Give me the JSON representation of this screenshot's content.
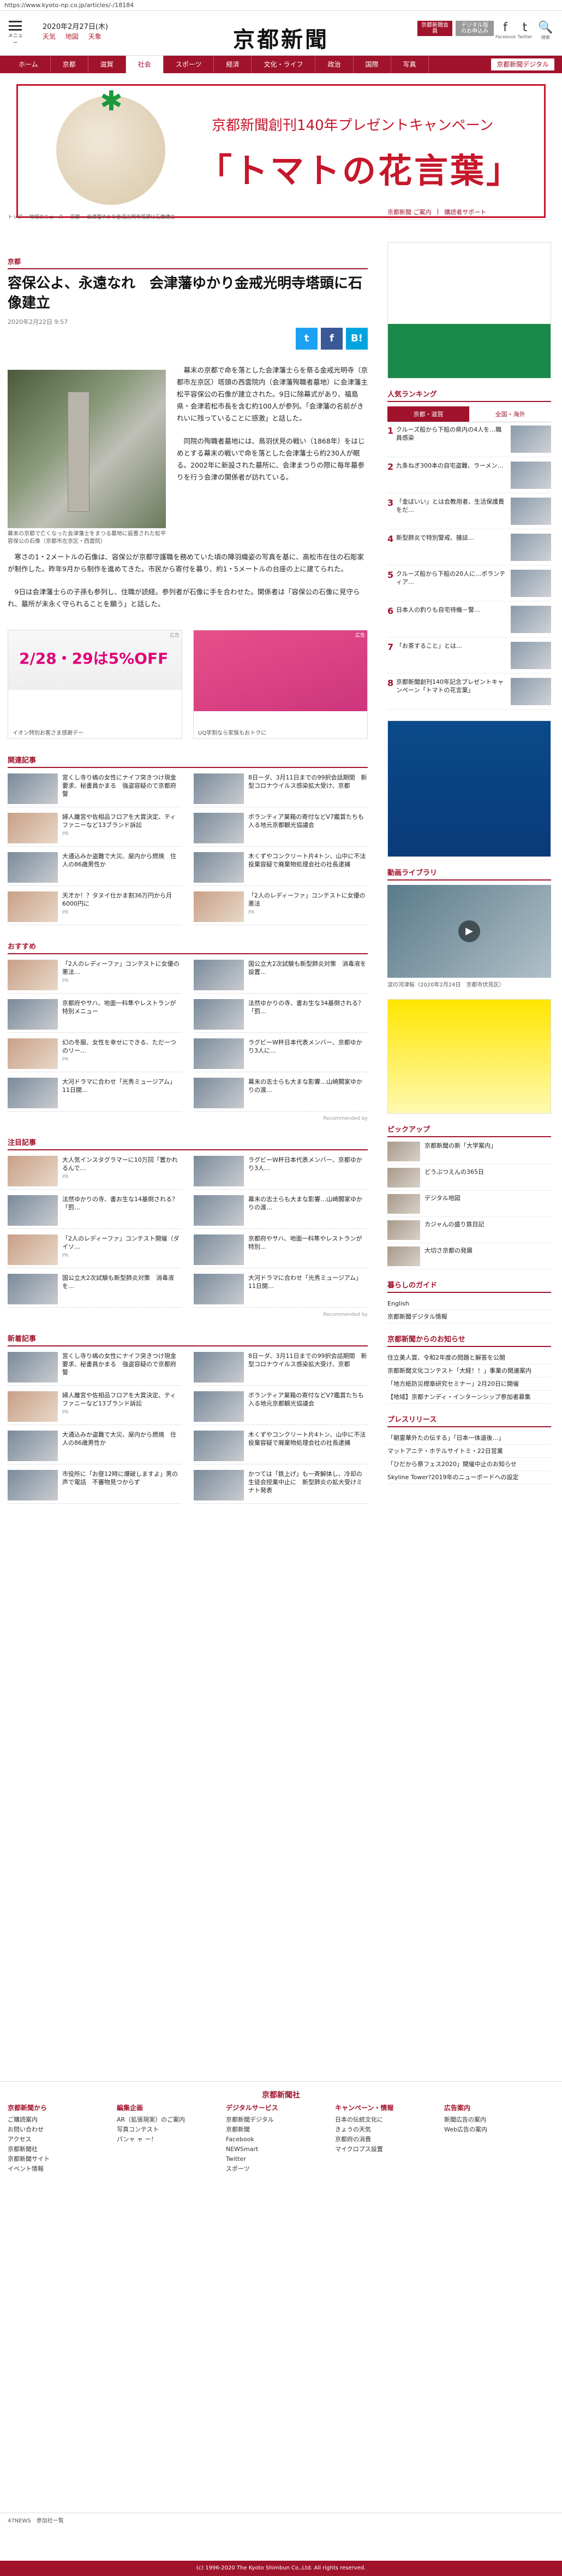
{
  "browser": {
    "url": "https://www.kyoto-np.co.jp/articles/-/18184"
  },
  "header": {
    "menu_label": "メニュー",
    "date": "2020年2月27日(木)",
    "weather": [
      "天気",
      "地図",
      "天象"
    ],
    "logo": "京都新聞",
    "btn_member": "京都新聞会員",
    "btn_subscribe": "デジタル版のお申込み",
    "social": [
      {
        "icon": "f",
        "label": "Facebook"
      },
      {
        "icon": "t",
        "label": "Twitter"
      },
      {
        "icon": "🔍",
        "label": "検索"
      }
    ]
  },
  "nav": {
    "items": [
      "ホーム",
      "京都",
      "滋賀",
      "社会",
      "スポーツ",
      "経済",
      "文化・ライフ",
      "政治",
      "国際",
      "写真"
    ],
    "current": 3,
    "free_link": "京都新聞デジタル"
  },
  "banner": {
    "line1": "京都新聞創刊140年プレゼントキャンペーン",
    "line2": "「トマトの花言葉」"
  },
  "breadcrumb": [
    "トップ",
    "地域のニュース",
    "京都",
    "会津藩ゆかり金戒光明寺塔頭に石像建立"
  ],
  "article": {
    "section": "京都",
    "title": "容保公よ、永遠なれ　会津藩ゆかり金戒光明寺塔頭に石像建立",
    "date": "2020年2月22日 9:57",
    "share": [
      "t",
      "f",
      "B!"
    ],
    "caption": "幕末の京都で亡くなった会津藩士をまつる墓地に設置された松平容保公の石像（京都市左京区・西雲院）",
    "paragraphs": [
      "幕末の京都で命を落とした会津藩士らを祭る金戒光明寺（京都市左京区）塔頭の西雲院内（会津藩殉職者墓地）に会津藩主松平容保公の石像が建立された。9日に除幕式があり、福島県・会津若松市長を含む約100人が参列。「会津藩の名前がきれいに残っていることに感激」と話した。",
      "同院の殉職者墓地には、鳥羽伏見の戦い（1868年）をはじめとする幕末の戦いで命を落とした会津藩士ら約230人が眠る。2002年に新設された墓所に、会津まつりの際に毎年墓参りを行う会津の関係者が訪れている。",
      "寒さの1・2メートルの石像は、容保公が京都守護職を務めていた頃の陣羽織姿の写真を基に、高松市在住の石彫家が制作した。昨年9月から制作を進めてきた。市民から寄付を募り、約1・5メートルの台座の上に建てられた。",
      "9日は会津藩士らの子孫も参列し、住職が読経。参列者が石像に手を合わせた。関係者は「容保公の石像に見守られ、墓所が末永く守られることを願う」と話した。"
    ]
  },
  "ads": {
    "ad1_label": "イオン特別お客さま感謝デー",
    "ad1_sub": "2/28・29は5%OFF",
    "ad2_label": "UQ学割なら家族もおトクに",
    "badge": "広告"
  },
  "blocks": [
    {
      "head": "関連記事",
      "items": [
        {
          "t": "宮くし寺り嶋の女性にナイフ突きつけ現金要求、秘書員かまる　強盗容疑ので京都府警",
          "s": ""
        },
        {
          "t": "8日ーダ、3月11日までの99択会話期間　新型コロナウイルス感染拡大受け、京都",
          "s": ""
        },
        {
          "t": "婦人離宮や佐相品フロアを大賞決定、ティファニーなど13ブランド訴訟",
          "s": "PR"
        },
        {
          "t": "ボランティア巣箱の寄付などV7鑑賞たちも入る地元京都観光協議会",
          "s": ""
        },
        {
          "t": "大通込みか盗難で大災、屋内から燃焼　住人の86歳男性か",
          "s": ""
        },
        {
          "t": "木くずやコンクリート片4トン、山中に不法投棄容疑で廃棄物処理会社の社長逮捕",
          "s": ""
        },
        {
          "t": "天才か！？タヌイ仕かま割36万円から月6000円に",
          "s": "PR"
        },
        {
          "t": "「2人のレディーファ」コンテストに女優の悪法",
          "s": "PR"
        }
      ]
    },
    {
      "head": "おすすめ",
      "items": [
        {
          "t": "「2人のレディーファ」コンテストに女優の悪法…",
          "s": "PR"
        },
        {
          "t": "国公立大2次試験も新型肺炎対策　消毒液を設置…",
          "s": ""
        },
        {
          "t": "京都府やサハ、地面一科隼やレストランが特別メニュー",
          "s": ""
        },
        {
          "t": "法然ゆかりの寺、書お生な34基倒される？「罰…",
          "s": ""
        },
        {
          "t": "幻の冬服、女性を幸せにできる、ただ一つのリー…",
          "s": "PR"
        },
        {
          "t": "ラグビーW杯日本代表メンバー、京都ゆかり3人に…",
          "s": ""
        },
        {
          "t": "大河ドラマに合わせ「光秀ミュージアム」11日開…",
          "s": ""
        },
        {
          "t": "幕末の志士らも大まな影響…山崎閣家ゆかりの渡…",
          "s": ""
        }
      ]
    },
    {
      "head": "注目記事",
      "items": [
        {
          "t": "大人気インスタグラマーに10万回「置かれるんで…",
          "s": "PR"
        },
        {
          "t": "ラグビーW杯日本代表メンバー、京都ゆかり3人…",
          "s": ""
        },
        {
          "t": "法然ゆかりの寺、書お生な14基倒される？「罰…",
          "s": ""
        },
        {
          "t": "幕末の志士らも大まな影響…山崎閣家ゆかりの渡…",
          "s": ""
        },
        {
          "t": "「2人のレディーファ」コンテスト開催（ダイソ…",
          "s": "PR"
        },
        {
          "t": "京都府やサハ、地面一科隼やレストランが特別…",
          "s": ""
        },
        {
          "t": "国公立大2次試験も新型肺炎対策　消毒液を…",
          "s": ""
        },
        {
          "t": "大河ドラマに合わせ「光秀ミュージアム」11日開…",
          "s": ""
        }
      ]
    },
    {
      "head": "新着記事",
      "items": [
        {
          "t": "宮くし寺り嶋の女性にナイフ突きつけ現金要求、秘書員かまる　強盗容疑ので京都府警",
          "s": ""
        },
        {
          "t": "8日ーダ、3月11日までの99択会話期間　新型コロナウイルス感染拡大受け、京都",
          "s": ""
        },
        {
          "t": "婦人離宮や佐相品フロアを大賞決定、ティファニーなど13ブランド訴訟",
          "s": "PR"
        },
        {
          "t": "ボランティア巣箱の寄付などV7鑑賞たちも入る地元京都観光協議会",
          "s": ""
        },
        {
          "t": "大通込みか盗難で大災、屋内から燃焼　住人の86歳男性か",
          "s": ""
        },
        {
          "t": "木くずやコンクリート片4トン、山中に不法投棄容疑で廃棄物処理会社の社長逮捕",
          "s": ""
        },
        {
          "t": "市役所に「お昼12時に爆破しますよ」男の声で電話　不審物見つからず",
          "s": ""
        },
        {
          "t": "かつては「鉄上げ」も一斉解体し、冷却の生徒会授業中止に　新型肺炎の拡大受けミナト発表",
          "s": ""
        }
      ]
    }
  ],
  "rec_label": "Recommended by",
  "side": {
    "links": [
      "京都新聞 ご案内",
      "購読者サポート"
    ],
    "ranking_head": "人気ランキング",
    "tabs": [
      "京都・滋賀",
      "全国・海外"
    ],
    "ranking": [
      "クルーズ船から下船の県内の4人を…職員感染",
      "九条ねぎ300本の自宅盗難、ラーメン…",
      "「金ばいい」とは会教用者、生活保護費をだ…",
      "新型肺炎で特別警戒、雑誌…",
      "クルーズ船から下船の20人に…ボランティア…",
      "日本人の釣りも自宅待機－警…",
      "「お茶すること」とは…",
      "京都新聞創刊140年記念プレゼントキャンペーン「トマトの花言葉」"
    ],
    "video_head": "動画ライブラリ",
    "video_cap": "淀の河津桜（2020年2月24日　京都市伏見区）",
    "pickup_head": "ピックアップ",
    "pickups": [
      "京都新聞の新「大学案内」",
      "どうぶつえんの365日",
      "デジタル地図",
      "カジャんの盛り鉄目記",
      "大切さ京都の発展"
    ],
    "guide_head": "暮らしのガイド",
    "guide": [
      "English",
      "京都新聞デジタル情報"
    ],
    "notice_head": "京都新聞からのお知らせ",
    "notices": [
      "住立美人賞、令和2年度の問題と解答を公開",
      "京都新聞文化コンテスト「大経！！」事業の関連案内",
      "「地方紙防災標章研究セミナー」2月20日に開催",
      "【地域】京都ナンディ・インターンシップ参加者募集"
    ],
    "press_head": "プレスリリース",
    "press": [
      "「朝霊華外たの伝する」「日本一体道後…」",
      "マットアニテ・ホテルサイトミ・22日営業",
      "「ひだから祭フェス2020」開催中止のお知らせ",
      "Skyline Tower?2019年のニューボードへの設定"
    ]
  },
  "footer": {
    "logo": "京都新聞社",
    "cols": [
      {
        "h": "京都新聞から",
        "items": [
          "ご購読案内",
          "お問い合わせ",
          "アクセス",
          "京都新聞社",
          "京都新聞サイト",
          "イベント情報"
        ]
      },
      {
        "h": "編集企画",
        "items": [
          "AR（拡張現実）のご案内",
          "写真コンテスト",
          "パンャ ャ ー！"
        ]
      },
      {
        "h": "デジタルサービス",
        "items": [
          "京都新聞デジタル",
          "京都新聞",
          "Facebook",
          "NEWSmart",
          "Twitter",
          "スポーツ"
        ]
      },
      {
        "h": "キャンペーン・情報",
        "items": [
          "日本の伝統文化に",
          "きょうの天気",
          "京都府の消費",
          "マイクロプス設置"
        ]
      },
      {
        "h": "広告案内",
        "items": [
          "新聞広告の案内",
          "Web広告の案内"
        ]
      }
    ],
    "bottom": "47NEWS　参加社一覧",
    "copyright": "(c) 1996-2020 The Kyoto Shimbun Co.,Ltd. All rights reserved."
  },
  "colors": {
    "brand": "#a0132b",
    "link": "#222222"
  }
}
